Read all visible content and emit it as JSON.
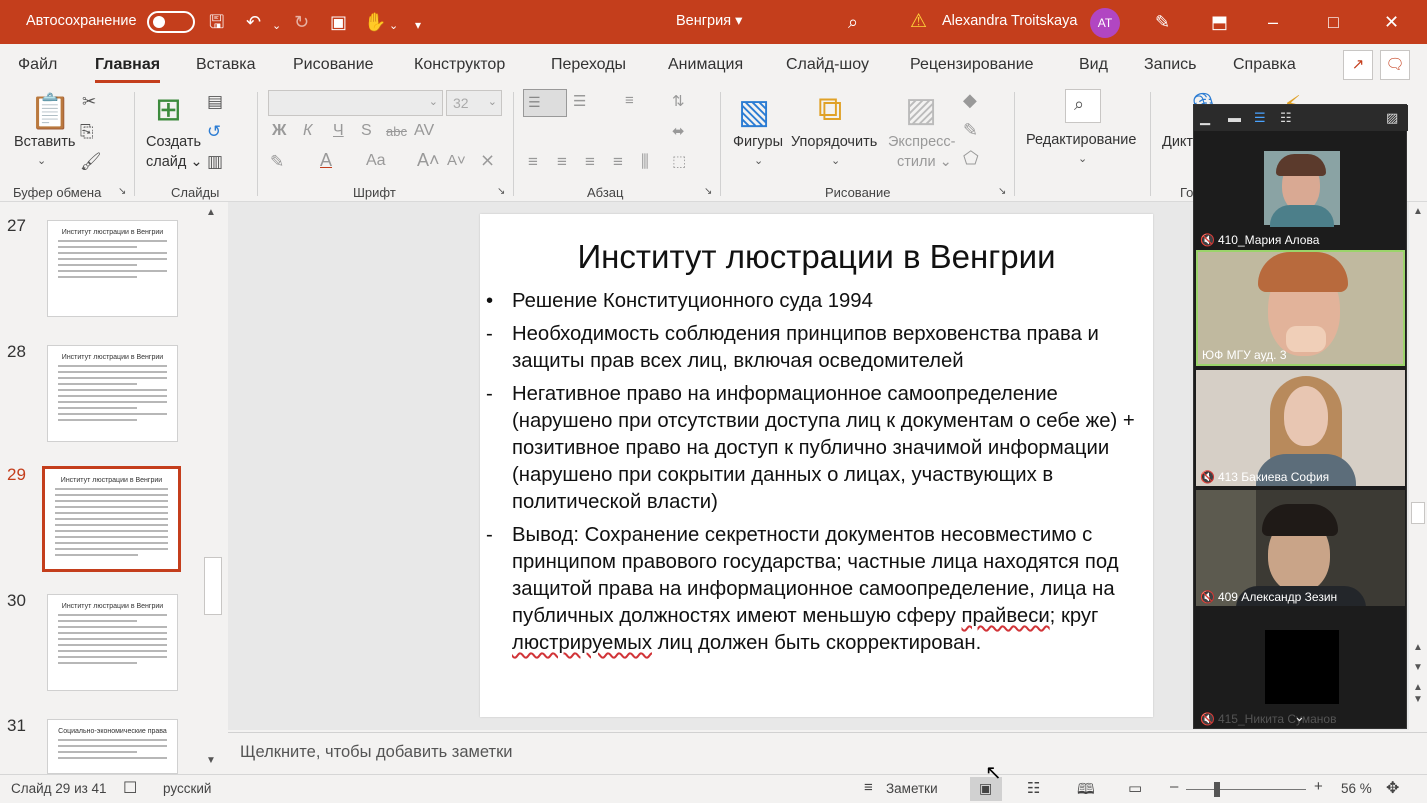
{
  "titlebar": {
    "autosave_label": "Автосохранение",
    "document_name": "Венгрия",
    "user_name": "Alexandra Troitskaya",
    "user_initials": "AT"
  },
  "ribbon_tabs": [
    "Файл",
    "Главная",
    "Вставка",
    "Рисование",
    "Конструктор",
    "Переходы",
    "Анимация",
    "Слайд-шоу",
    "Рецензирование",
    "Вид",
    "Запись",
    "Справка"
  ],
  "ribbon": {
    "paste_label": "Вставить",
    "create_slide_label_1": "Создать",
    "create_slide_label_2": "слайд",
    "font_size": "32",
    "font_bold": "Ж",
    "font_italic": "К",
    "font_underline": "Ч",
    "font_shadow": "S",
    "font_strike": "abc",
    "shapes_label": "Фигуры",
    "arrange_label": "Упорядочить",
    "styles_label_1": "Экспресс-",
    "styles_label_2": "стили",
    "editing_label": "Редактирование",
    "dictate_label": "Дикт",
    "groups": {
      "clipboard": "Буфер обмена",
      "slides": "Слайды",
      "font": "Шрифт",
      "paragraph": "Абзац",
      "drawing": "Рисование",
      "voice": "Го"
    }
  },
  "thumbnails": [
    {
      "num": "27",
      "title": "Институт люстрации в Венгрии"
    },
    {
      "num": "28",
      "title": "Институт люстрации в Венгрии"
    },
    {
      "num": "29",
      "title": "Институт люстрации в Венгрии"
    },
    {
      "num": "30",
      "title": "Институт люстрации в Венгрии"
    },
    {
      "num": "31",
      "title": "Социально-экономические права"
    }
  ],
  "slide": {
    "title": "Институт люстрации в Венгрии",
    "bullets": [
      {
        "marker": "•",
        "text": "Решение Конституционного суда 1994"
      },
      {
        "marker": "-",
        "text": "Необходимость соблюдения принципов верховенства права и защиты прав всех лиц, включая осведомителей"
      },
      {
        "marker": "-",
        "text": "Негативное право на информационное самоопределение (нарушено при отсутствии доступа лиц к документам о себе же) + позитивное право на доступ к публично значимой информации (нарушено при сокрытии данных о лицах, участвующих в политической власти)"
      },
      {
        "marker": "-",
        "text_before": "Вывод: Сохранение секретности документов несовместимо с принципом правового государства; частные лица находятся под защитой права на информационное самоопределение, лица на публичных должностях имеют меньшую сферу ",
        "squiggle_1": "прайвеси",
        "text_middle": "; круг ",
        "squiggle_2": "люстрируемых",
        "text_after": " лиц должен быть скорректирован."
      }
    ]
  },
  "notes_placeholder": "Щелкните, чтобы добавить заметки",
  "status": {
    "slide_counter": "Слайд 29 из 41",
    "language": "русский",
    "notes_button": "Заметки",
    "zoom": "56 %"
  },
  "video_panel": {
    "participants": [
      {
        "name": "410_Мария Алова"
      },
      {
        "name": "ЮФ МГУ ауд. 3"
      },
      {
        "name": "413 Бакиева София"
      },
      {
        "name": "409 Александр Зезин"
      },
      {
        "name": "415_Никита Суманов"
      }
    ]
  },
  "colors": {
    "accent": "#c43e1c",
    "highlight_border": "#9bd46a"
  }
}
